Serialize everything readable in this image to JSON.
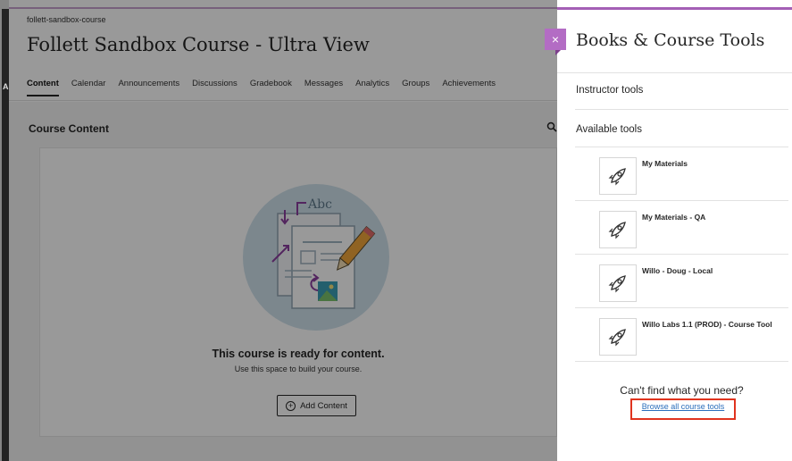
{
  "course": {
    "slug": "follett-sandbox-course",
    "title": "Follett Sandbox Course - Ultra View",
    "nav": [
      "Content",
      "Calendar",
      "Announcements",
      "Discussions",
      "Gradebook",
      "Messages",
      "Analytics",
      "Groups",
      "Achievements"
    ],
    "content_heading": "Course Content",
    "ready_title": "This course is ready for content.",
    "ready_subtitle": "Use this space to build your course.",
    "add_content_label": "Add Content",
    "illustration_text": "Abc",
    "edge_letter": "A"
  },
  "panel": {
    "close_glyph": "×",
    "title": "Books & Course Tools",
    "instructor_tools_label": "Instructor tools",
    "available_tools_label": "Available tools",
    "tools": [
      {
        "name": "My Materials",
        "icon": "rocket-icon"
      },
      {
        "name": "My Materials - QA",
        "icon": "rocket-icon"
      },
      {
        "name": "Willo - Doug - Local",
        "icon": "rocket-icon"
      },
      {
        "name": "Willo Labs 1.1 (PROD) - Course Tool",
        "icon": "rocket-icon"
      }
    ],
    "cant_find": "Can't find what you need?",
    "browse_link": "Browse all course tools"
  },
  "colors": {
    "accent_purple": "#b36cc4",
    "highlight_red": "#e0331e",
    "link_blue": "#2a6ebb"
  }
}
